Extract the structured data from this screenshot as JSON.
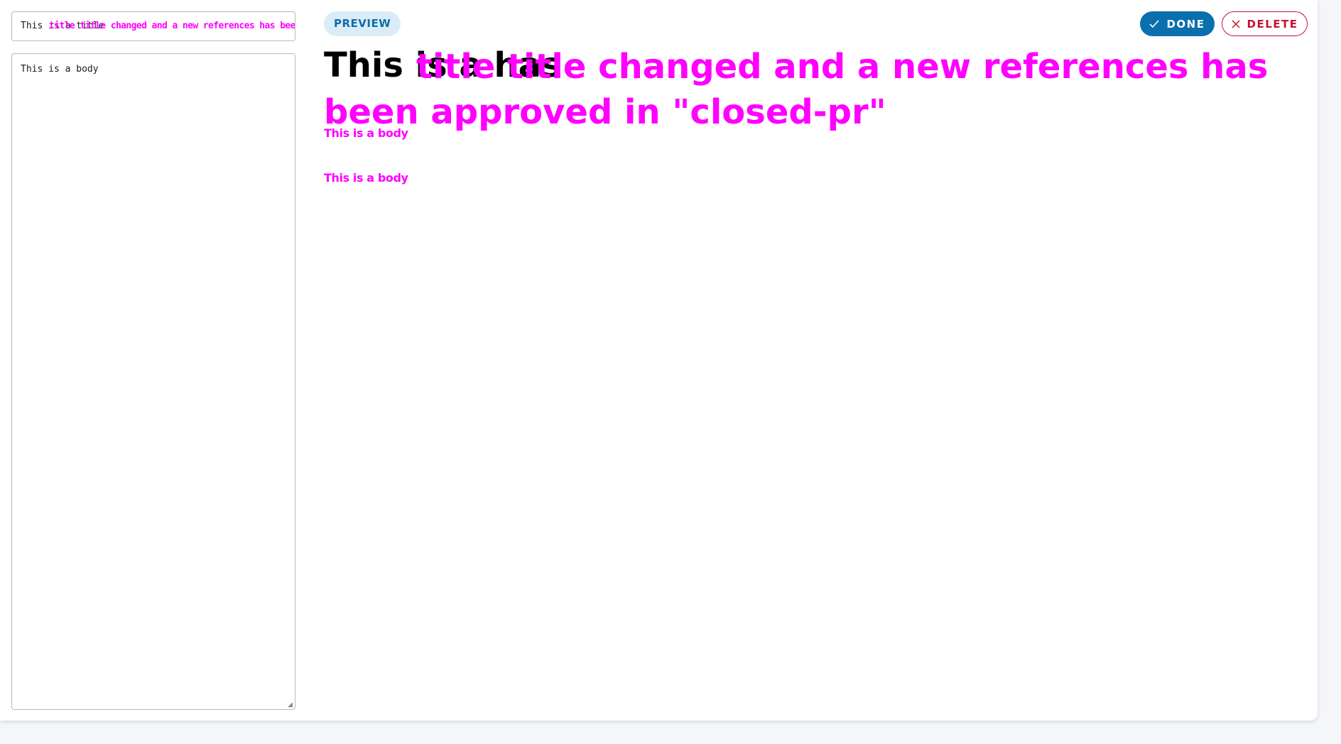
{
  "editor": {
    "title_value": "This is a title",
    "title_overlay": "title title changed and a new references has been approved in \"closed-pr\"",
    "body_value": "This is a body"
  },
  "preview": {
    "badge_label": "PREVIEW",
    "title_base": "This is a    has",
    "title_overlay": "title title changed and a new references has been approved in \"closed-pr\"",
    "body_1": "This is a body",
    "body_2": "This is a body"
  },
  "actions": {
    "done_label": "DONE",
    "delete_label": "DELETE",
    "done_icon": "check-icon",
    "delete_icon": "close-icon"
  },
  "colors": {
    "accent": "#0a6fae",
    "danger": "#c8102e",
    "overlay": "#ff00ff",
    "badge_bg": "#dcecf7"
  }
}
